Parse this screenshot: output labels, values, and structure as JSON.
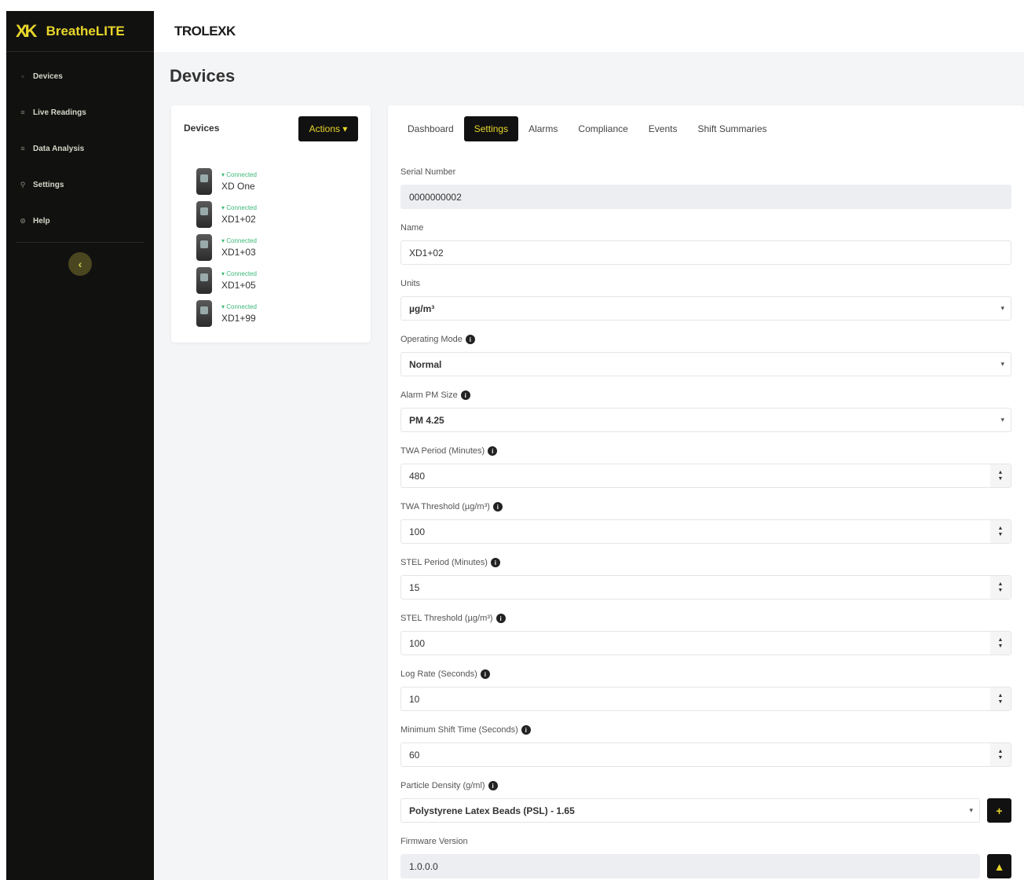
{
  "sidebar": {
    "brand_mark": "XK",
    "brand_name": "BreatheLITE",
    "items": [
      {
        "label": "Devices",
        "icon": "devices-icon",
        "glyph": "▫"
      },
      {
        "label": "Live Readings",
        "icon": "list-icon",
        "glyph": "≡"
      },
      {
        "label": "Data Analysis",
        "icon": "chart-icon",
        "glyph": "≡"
      },
      {
        "label": "Settings",
        "icon": "wrench-icon",
        "glyph": "⚲"
      },
      {
        "label": "Help",
        "icon": "help-icon",
        "glyph": "⊙"
      }
    ],
    "collapse_glyph": "‹"
  },
  "header": {
    "logo": "TROLEXK"
  },
  "page": {
    "title": "Devices"
  },
  "devices_panel": {
    "title": "Devices",
    "actions_label": "Actions ▾",
    "devices": [
      {
        "status": "▾ Connected",
        "name": "XD One"
      },
      {
        "status": "▾ Connected",
        "name": "XD1+02"
      },
      {
        "status": "▾ Connected",
        "name": "XD1+03"
      },
      {
        "status": "▾ Connected",
        "name": "XD1+05"
      },
      {
        "status": "▾ Connected",
        "name": "XD1+99"
      }
    ]
  },
  "tabs": [
    {
      "label": "Dashboard"
    },
    {
      "label": "Settings",
      "active": true
    },
    {
      "label": "Alarms"
    },
    {
      "label": "Compliance"
    },
    {
      "label": "Events"
    },
    {
      "label": "Shift Summaries"
    }
  ],
  "form": {
    "serial_number": {
      "label": "Serial Number",
      "value": "0000000002"
    },
    "name": {
      "label": "Name",
      "value": "XD1+02"
    },
    "units": {
      "label": "Units",
      "value": "µg/m³"
    },
    "operating_mode": {
      "label": "Operating Mode",
      "value": "Normal"
    },
    "alarm_pm_size": {
      "label": "Alarm PM Size",
      "value": "PM 4.25"
    },
    "twa_period": {
      "label": "TWA Period (Minutes)",
      "value": "480"
    },
    "twa_threshold": {
      "label": "TWA Threshold (µg/m³)",
      "value": "100"
    },
    "stel_period": {
      "label": "STEL Period (Minutes)",
      "value": "15"
    },
    "stel_threshold": {
      "label": "STEL Threshold (µg/m³)",
      "value": "100"
    },
    "log_rate": {
      "label": "Log Rate (Seconds)",
      "value": "10"
    },
    "min_shift_time": {
      "label": "Minimum Shift Time (Seconds)",
      "value": "60"
    },
    "particle_density": {
      "label": "Particle Density (g/ml)",
      "value": "Polystyrene Latex Beads (PSL) - 1.65",
      "add_glyph": "+"
    },
    "firmware_version": {
      "label": "Firmware Version",
      "value": "1.0.0.0",
      "upload_glyph": "▲"
    }
  },
  "colors": {
    "accent": "#e8d62a",
    "sidebar_bg": "#111110",
    "connected": "#3cb878"
  }
}
